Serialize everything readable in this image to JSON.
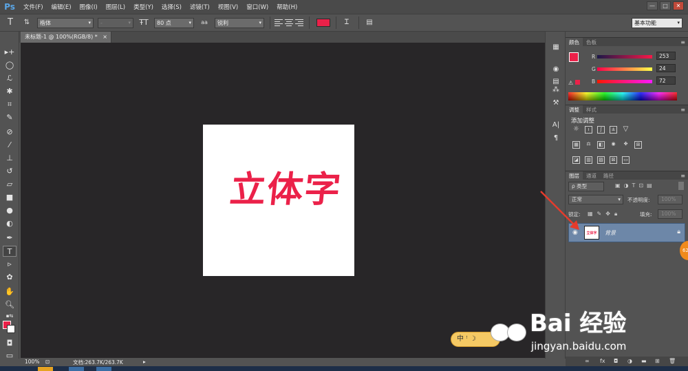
{
  "menubar": {
    "logo": "Ps",
    "items": [
      "文件(F)",
      "编辑(E)",
      "图像(I)",
      "图层(L)",
      "类型(Y)",
      "选择(S)",
      "滤镜(T)",
      "视图(V)",
      "窗口(W)",
      "帮助(H)"
    ]
  },
  "window_controls": {
    "minimize": "—",
    "maximize": "□",
    "close": "✕"
  },
  "options": {
    "font_family": "楷体",
    "font_style": "-",
    "font_size": "80 点",
    "aa_label": "aa",
    "antialias": "锐利",
    "text_color": "#eb2149",
    "workspace": "基本功能"
  },
  "document": {
    "tab_title": "未标题-1 @ 100%(RGB/8) *",
    "tab_close": "×",
    "text": "立体字",
    "text_color": "#eb2149"
  },
  "status": {
    "zoom": "100%",
    "doc_size": "文档:263.7K/263.7K"
  },
  "color_panel": {
    "tabs": [
      "颜色",
      "色板"
    ],
    "r_label": "R",
    "r_value": "253",
    "g_label": "G",
    "g_value": "24",
    "b_label": "B",
    "b_value": "72",
    "fg_color": "#eb2149"
  },
  "adjust_panel": {
    "tabs": [
      "调整",
      "样式"
    ],
    "title": "添加调整"
  },
  "layers_panel": {
    "tabs": [
      "图层",
      "通道",
      "路径"
    ],
    "filter_label": "ρ 类型",
    "blend_mode": "正常",
    "opacity_label": "不透明度:",
    "opacity_value": "100%",
    "lock_label": "锁定:",
    "fill_label": "填充:",
    "fill_value": "100%",
    "layer_name": "背景",
    "layer_thumb_text": "立体字"
  },
  "watermark": {
    "badge": "中 ꜝ ☽",
    "logo": "Bai 经验",
    "url": "jingyan.baidu.com",
    "side_badge": "62"
  }
}
